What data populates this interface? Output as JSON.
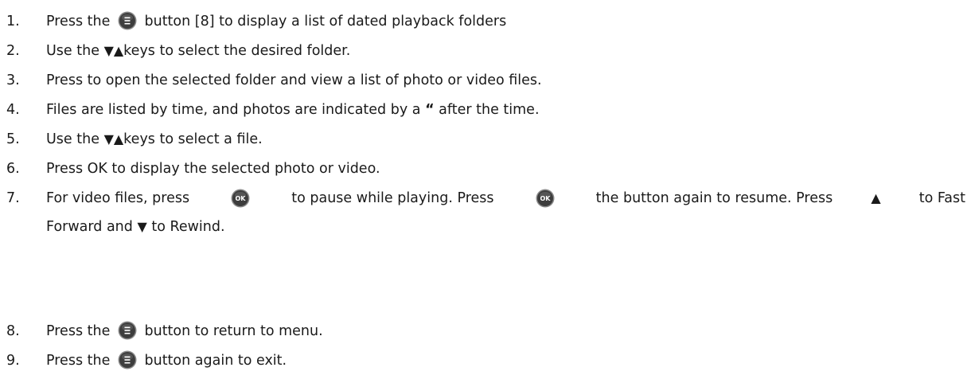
{
  "steps": [
    {
      "num": "1.",
      "parts": [
        "Press  the",
        "button [8] to display a list of dated playback folders"
      ]
    },
    {
      "num": "2.",
      "parts": [
        "Use the",
        "▼▲",
        "keys to select the desired folder."
      ]
    },
    {
      "num": "3.",
      "parts": [
        "Press   to open the selected folder and view a list of photo or video files."
      ]
    },
    {
      "num": "4.",
      "parts": [
        "Files are listed by time, and photos are indicated by a",
        "“",
        "after the time."
      ]
    },
    {
      "num": "5.",
      "parts": [
        "Use the",
        "▼▲",
        "keys to select a file."
      ]
    },
    {
      "num": "6.",
      "parts": [
        "Press OK to display the selected photo or video."
      ]
    },
    {
      "num": "7.",
      "parts": [
        "For video files, press",
        "to pause while playing. Press",
        "the  button again to resume. Press",
        "▲",
        "to Fast",
        "Forward and",
        "▼",
        "to Rewind."
      ]
    },
    {
      "num": "8.",
      "parts": [
        "Press the",
        "button to return to menu."
      ]
    },
    {
      "num": "9.",
      "parts": [
        "Press the",
        "button again to exit."
      ]
    }
  ],
  "icons": {
    "menu_icon": "menu-button-icon",
    "ok_icon": "ok-button-icon",
    "ok_label": "OK",
    "button_fill": "#3d3d3d",
    "button_ring": "#8a8a8a",
    "glyph_color": "#ffffff"
  }
}
